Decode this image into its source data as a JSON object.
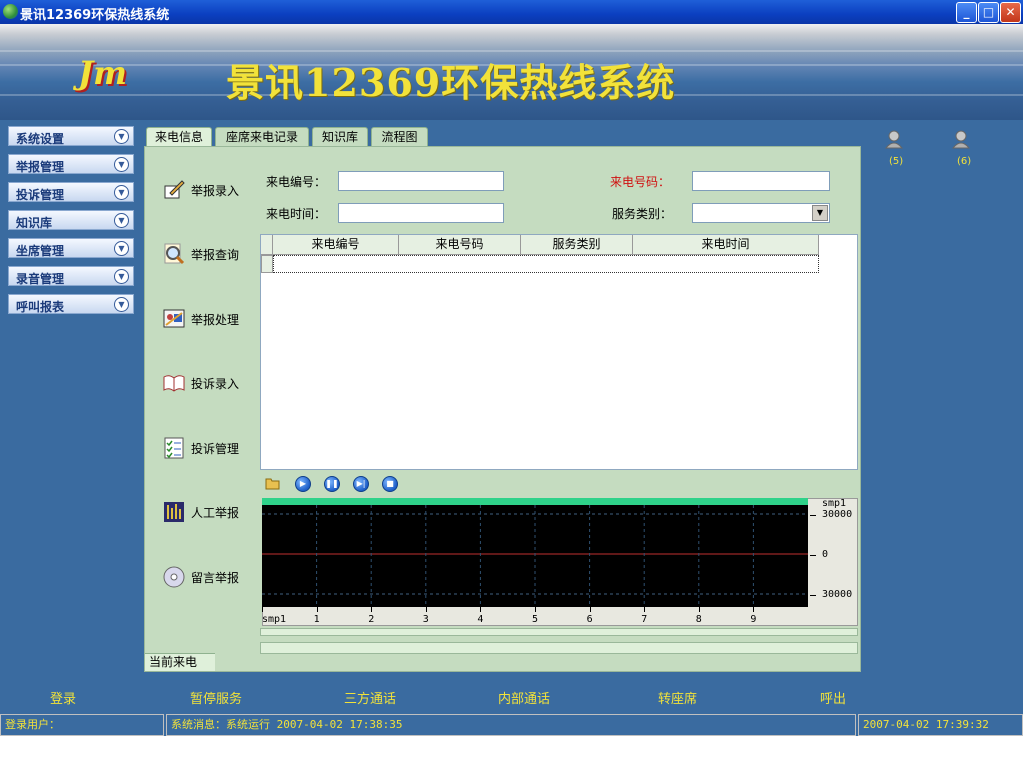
{
  "window": {
    "title": "景讯12369环保热线系统"
  },
  "banner": {
    "logo": "Jm",
    "title": "景讯12369环保热线系统"
  },
  "sidebar": {
    "items": [
      {
        "label": "系统设置"
      },
      {
        "label": "举报管理"
      },
      {
        "label": "投诉管理"
      },
      {
        "label": "知识库"
      },
      {
        "label": "坐席管理"
      },
      {
        "label": "录音管理"
      },
      {
        "label": "呼叫报表"
      }
    ]
  },
  "tabs": [
    {
      "label": "来电信息"
    },
    {
      "label": "座席来电记录"
    },
    {
      "label": "知识库"
    },
    {
      "label": "流程图"
    }
  ],
  "actions": [
    {
      "label": "举报录入",
      "icon": "pen-paper-icon"
    },
    {
      "label": "举报查询",
      "icon": "magnifier-icon"
    },
    {
      "label": "举报处理",
      "icon": "process-icon"
    },
    {
      "label": "投诉录入",
      "icon": "open-book-icon"
    },
    {
      "label": "投诉管理",
      "icon": "checklist-icon"
    },
    {
      "label": "人工举报",
      "icon": "equalizer-icon"
    },
    {
      "label": "留言举报",
      "icon": "cd-icon"
    }
  ],
  "form": {
    "call_id_label": "来电编号：",
    "call_id_value": "",
    "call_number_label": "来电号码：",
    "call_number_value": "",
    "call_time_label": "来电时间：",
    "call_time_value": "",
    "service_type_label": "服务类别：",
    "service_type_value": ""
  },
  "grid": {
    "columns": [
      "来电编号",
      "来电号码",
      "服务类别",
      "来电时间"
    ]
  },
  "player": {
    "buttons": [
      "open-folder-icon",
      "play-icon",
      "pause-icon",
      "next-icon",
      "stop-icon"
    ],
    "channel": "smp1",
    "y_ticks": [
      "30000",
      "0",
      "30000"
    ],
    "x_ticks": [
      "smp1",
      "1",
      "2",
      "3",
      "4",
      "5",
      "6",
      "7",
      "8",
      "9"
    ],
    "wave_color": "#2fd28a"
  },
  "panel": {
    "current_call_label": "当前来电"
  },
  "agents": [
    {
      "label": "(5)"
    },
    {
      "label": "(6)"
    }
  ],
  "bottom_buttons": [
    "登录",
    "暂停服务",
    "三方通话",
    "内部通话",
    "转座席",
    "呼出"
  ],
  "status": {
    "user": "登录用户：",
    "message": "系统消息：系统运行 2007-04-02 17:38:35",
    "clock": "2007-04-02 17:39:32"
  },
  "colors": {
    "accent_yellow": "#f2e23a",
    "panel_green": "#c5dcc0",
    "main_blue": "#3a6ba0",
    "required_red": "#d01010"
  }
}
